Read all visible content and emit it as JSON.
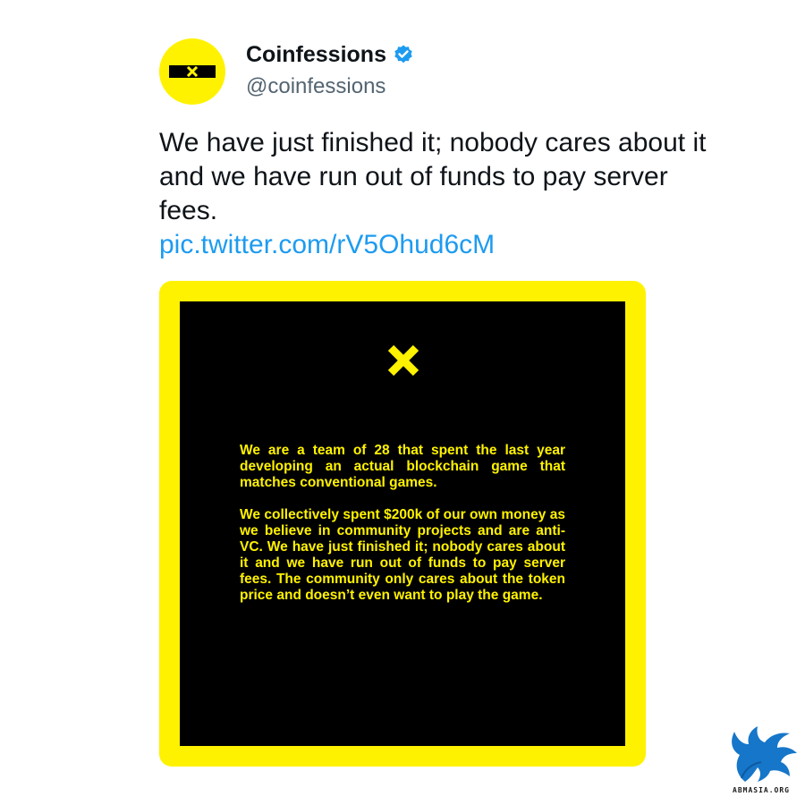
{
  "colors": {
    "brand_yellow": "#FFF200",
    "text_primary": "#0f1419",
    "text_secondary": "#536471",
    "link": "#1d9bf0",
    "verified": "#1d9bf0",
    "watermark_blue": "#1676c9"
  },
  "author": {
    "display_name": "Coinfessions",
    "handle": "@coinfessions",
    "verified": true,
    "avatar_icon": "x-logo-icon",
    "verified_icon": "verified-badge-icon"
  },
  "tweet": {
    "text": "We have just finished it; nobody cares about it and we have run out of funds to pay server fees.",
    "link": "pic.twitter.com/rV5Ohud6cM"
  },
  "media": {
    "icon": "x-logo-icon",
    "paragraphs": [
      "We are a team of 28 that spent the last year developing an actual blockchain game that matches conventional games.",
      "We collectively spent $200k of our own money as we believe in community projects and are anti-VC. We have just finished it; nobody cares about it and we have run out of funds to pay server fees. The community only cares about the token price and doesn’t even want to play the game."
    ]
  },
  "watermark": {
    "icon": "griffin-logo-icon",
    "text": "ABMASIA.ORG"
  }
}
